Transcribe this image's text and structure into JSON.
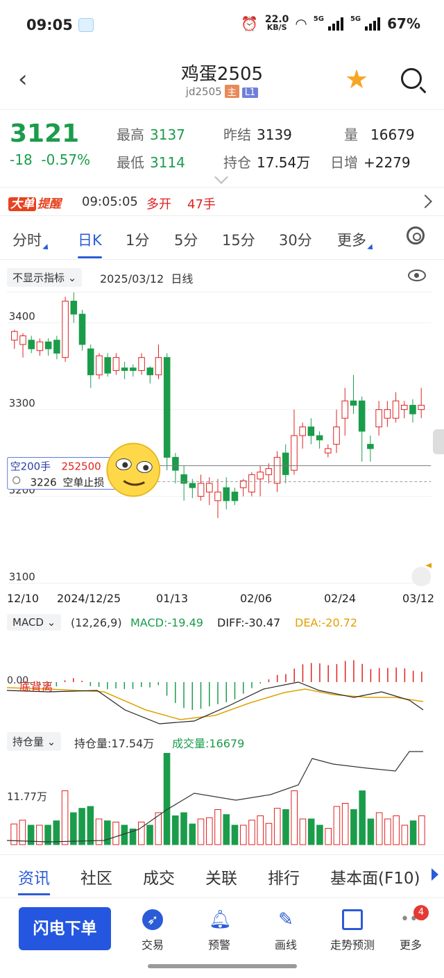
{
  "status": {
    "time": "09:05",
    "speed_value": "22.0",
    "speed_unit": "KB/S",
    "battery": "67%",
    "net1": "5G",
    "net2": "5G"
  },
  "nav": {
    "title": "鸡蛋2505",
    "code": "jd2505",
    "tag_main": "主",
    "tag_level": "L1"
  },
  "quote": {
    "price": "3121",
    "change": "-18",
    "change_pct": "-0.57%",
    "high_label": "最高",
    "high": "3137",
    "low_label": "最低",
    "low": "3114",
    "prev_settle_label": "昨结",
    "prev_settle": "3139",
    "open_interest_label": "持仓",
    "open_interest": "17.54万",
    "volume_label": "量",
    "volume": "16679",
    "daily_inc_label": "日增",
    "daily_inc": "+2279"
  },
  "alert": {
    "badge_a": "大单",
    "badge_b": "提醒",
    "time": "09:05:05",
    "direction": "多开",
    "lots": "47手"
  },
  "tabs": [
    "分时",
    "日K",
    "1分",
    "5分",
    "15分",
    "30分",
    "更多"
  ],
  "controls": {
    "indicator": "不显示指标",
    "date": "2025/03/12",
    "period": "日线"
  },
  "chart_overlay": {
    "short_label": "空200手",
    "short_value": "252500",
    "stop_price": "3226",
    "stop_label": "空单止损"
  },
  "x_labels": [
    "12/10",
    "2024/12/25",
    "01/13",
    "02/06",
    "02/24",
    "03/12"
  ],
  "macd": {
    "name": "MACD",
    "params": "(12,26,9)",
    "macd": "MACD:-19.49",
    "diff": "DIFF:-30.47",
    "dea": "DEA:-20.72",
    "zero": "0.00",
    "note": "底背离"
  },
  "vol": {
    "name": "持仓量",
    "oi": "持仓量:17.54万",
    "volume": "成交量:16679",
    "axis": "11.77万"
  },
  "footer_tabs": [
    "资讯",
    "社区",
    "成交",
    "关联",
    "排行",
    "基本面(F10)"
  ],
  "bottom": {
    "order": "闪电下单",
    "items": [
      "交易",
      "预警",
      "画线",
      "走势预测",
      "更多"
    ],
    "badge": "4"
  },
  "chart_data": {
    "type": "candlestick",
    "y_ticks": [
      "3400",
      "3300",
      "3200",
      "3100"
    ],
    "ylim": [
      3090,
      3435
    ],
    "x_ticks": [
      "12/10",
      "2024/12/25",
      "01/13",
      "02/06",
      "02/24",
      "03/12"
    ],
    "colors": {
      "up": "#e02020",
      "down": "#1b9c4b"
    },
    "candles": [
      [
        3380,
        3390,
        3370,
        3392
      ],
      [
        3375,
        3385,
        3360,
        3388
      ],
      [
        3380,
        3370,
        3365,
        3385
      ],
      [
        3368,
        3378,
        3362,
        3382
      ],
      [
        3378,
        3370,
        3362,
        3382
      ],
      [
        3380,
        3365,
        3358,
        3385
      ],
      [
        3360,
        3425,
        3355,
        3430
      ],
      [
        3425,
        3410,
        3400,
        3440
      ],
      [
        3410,
        3375,
        3368,
        3415
      ],
      [
        3370,
        3340,
        3325,
        3375
      ],
      [
        3340,
        3362,
        3335,
        3365
      ],
      [
        3360,
        3342,
        3338,
        3365
      ],
      [
        3345,
        3360,
        3340,
        3365
      ],
      [
        3348,
        3345,
        3335,
        3355
      ],
      [
        3348,
        3345,
        3338,
        3352
      ],
      [
        3345,
        3360,
        3340,
        3365
      ],
      [
        3348,
        3340,
        3330,
        3350
      ],
      [
        3340,
        3360,
        3335,
        3375
      ],
      [
        3360,
        3245,
        3230,
        3365
      ],
      [
        3245,
        3230,
        3215,
        3250
      ],
      [
        3225,
        3215,
        3195,
        3235
      ],
      [
        3215,
        3210,
        3198,
        3220
      ],
      [
        3200,
        3215,
        3195,
        3225
      ],
      [
        3205,
        3215,
        3190,
        3222
      ],
      [
        3195,
        3205,
        3175,
        3220
      ],
      [
        3210,
        3195,
        3185,
        3222
      ],
      [
        3205,
        3195,
        3190,
        3210
      ],
      [
        3210,
        3218,
        3200,
        3220
      ],
      [
        3205,
        3225,
        3200,
        3228
      ],
      [
        3220,
        3228,
        3200,
        3235
      ],
      [
        3225,
        3232,
        3215,
        3238
      ],
      [
        3215,
        3245,
        3205,
        3252
      ],
      [
        3250,
        3225,
        3215,
        3260
      ],
      [
        3230,
        3270,
        3225,
        3300
      ],
      [
        3270,
        3280,
        3255,
        3285
      ],
      [
        3280,
        3270,
        3260,
        3290
      ],
      [
        3270,
        3265,
        3255,
        3275
      ],
      [
        3250,
        3255,
        3245,
        3260
      ],
      [
        3260,
        3280,
        3250,
        3300
      ],
      [
        3290,
        3310,
        3270,
        3325
      ],
      [
        3310,
        3305,
        3295,
        3340
      ],
      [
        3310,
        3275,
        3240,
        3315
      ],
      [
        3260,
        3255,
        3240,
        3270
      ],
      [
        3280,
        3300,
        3270,
        3310
      ],
      [
        3290,
        3300,
        3280,
        3310
      ],
      [
        3290,
        3310,
        3285,
        3320
      ],
      [
        3300,
        3305,
        3290,
        3310
      ],
      [
        3305,
        3295,
        3285,
        3312
      ],
      [
        3300,
        3305,
        3290,
        3325
      ]
    ]
  }
}
